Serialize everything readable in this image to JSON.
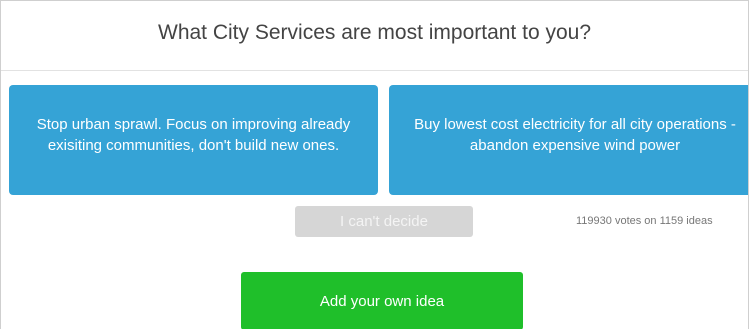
{
  "header": {
    "question": "What City Services are most important to you?"
  },
  "choices": [
    {
      "text": "Stop urban sprawl. Focus on improving already exisiting communities, don't build new ones."
    },
    {
      "text": "Buy lowest cost electricity for all city operations - abandon expensive wind power"
    }
  ],
  "actions": {
    "cant_decide_label": "I can't decide",
    "add_idea_label": "Add your own idea"
  },
  "stats": {
    "votes_text": "119930 votes on 1159 ideas"
  },
  "colors": {
    "choice_bg": "#35a3d6",
    "cant_decide_bg": "#d6d6d6",
    "add_idea_bg": "#1fbf2a"
  }
}
